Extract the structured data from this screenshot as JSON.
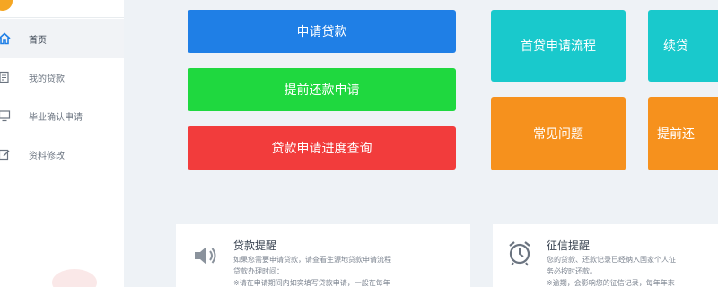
{
  "sidebar": {
    "items": [
      {
        "label": "首页",
        "icon": "home-icon",
        "active": true
      },
      {
        "label": "我的贷款",
        "icon": "document-icon",
        "active": false
      },
      {
        "label": "毕业确认申请",
        "icon": "monitor-icon",
        "active": false
      },
      {
        "label": "资料修改",
        "icon": "edit-icon",
        "active": false
      }
    ]
  },
  "actions": {
    "apply_loan": "申请贷款",
    "early_repayment": "提前还款申请",
    "progress_query": "贷款申请进度查询"
  },
  "tiles": {
    "first_loan_process": "首贷申请流程",
    "renew_loan": "续贷",
    "faq": "常见问题",
    "early_repay": "提前还"
  },
  "cards": {
    "loan_notice": {
      "title": "贷款提醒",
      "line1": "如果您需要申请贷款，请查看生源地贷款申请流程",
      "line2": "贷款办理时间：",
      "line3": "※请在申请期间内如实填写贷款申请，一般在每年"
    },
    "credit_notice": {
      "title": "征信提醒",
      "line1": "您的贷款、还款记录已经纳入国家个人征",
      "line2": "务必按时还款。",
      "line3": "※逾期，会影响您的征信记录，每年年末"
    }
  },
  "colors": {
    "blue": "#1f7fe6",
    "green": "#1fd83f",
    "red": "#f23c3c",
    "teal": "#19c9cc",
    "orange": "#f6911d",
    "background": "#eef2f6"
  }
}
